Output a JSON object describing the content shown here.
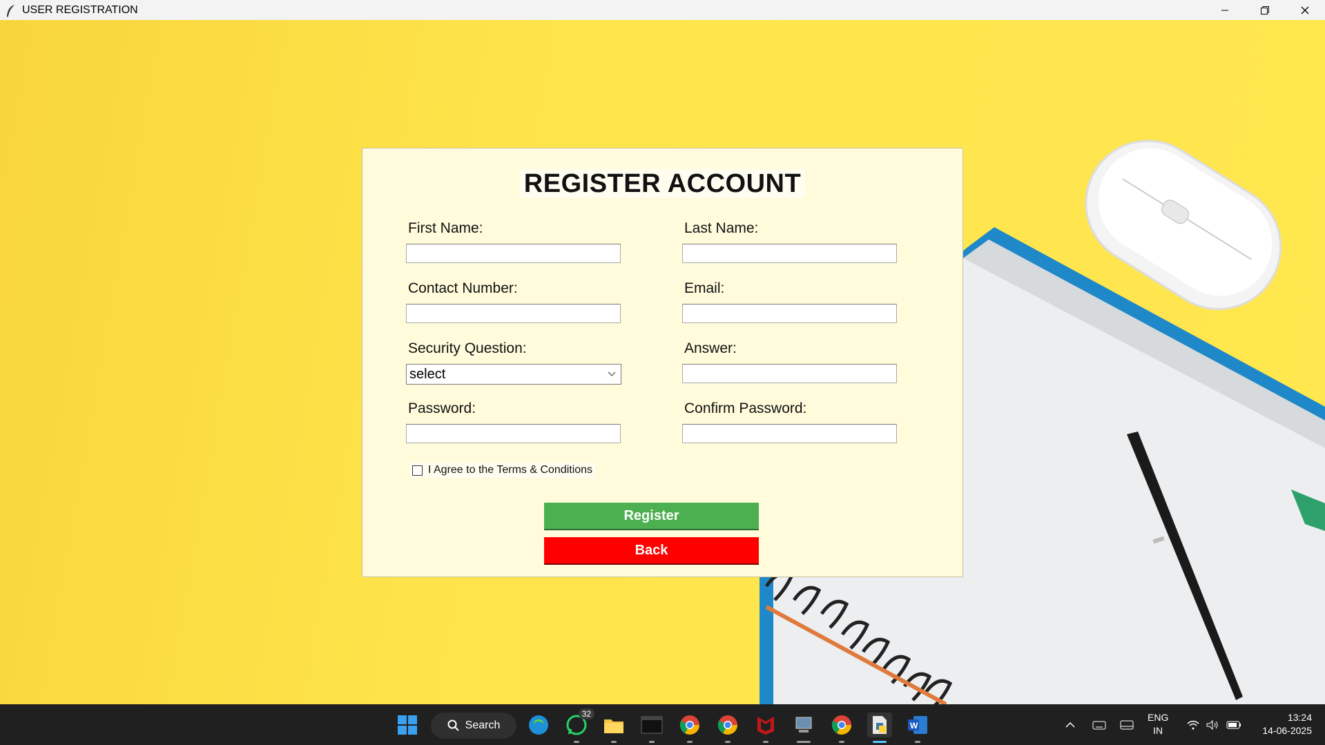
{
  "window": {
    "title": "USER REGISTRATION"
  },
  "form": {
    "heading": "REGISTER ACCOUNT",
    "fields": {
      "first_name": {
        "label": "First Name:",
        "value": ""
      },
      "last_name": {
        "label": "Last Name:",
        "value": ""
      },
      "contact": {
        "label": "Contact Number:",
        "value": ""
      },
      "email": {
        "label": "Email:",
        "value": ""
      },
      "security_question": {
        "label": "Security Question:",
        "value": "select"
      },
      "answer": {
        "label": "Answer:",
        "value": ""
      },
      "password": {
        "label": "Password:",
        "value": ""
      },
      "confirm_password": {
        "label": "Confirm Password:",
        "value": ""
      }
    },
    "agree_label": "I Agree to the Terms & Conditions",
    "agree_checked": false,
    "register_label": "Register",
    "back_label": "Back",
    "colors": {
      "register": "#4caf50",
      "back": "#ff0000",
      "card": "#fffbdb",
      "background": "#ffe449"
    }
  },
  "taskbar": {
    "search_label": "Search",
    "whatsapp_badge": "32",
    "language": {
      "line1": "ENG",
      "line2": "IN"
    },
    "clock": {
      "time": "13:24",
      "date": "14-06-2025"
    },
    "icons": [
      "windows-start-icon",
      "search-icon",
      "edge-icon",
      "whatsapp-icon",
      "file-explorer-icon",
      "terminal-icon",
      "chrome-icon",
      "chrome-icon",
      "mcafee-icon",
      "network-app-icon",
      "chrome-icon",
      "python-idle-icon",
      "word-icon"
    ]
  }
}
